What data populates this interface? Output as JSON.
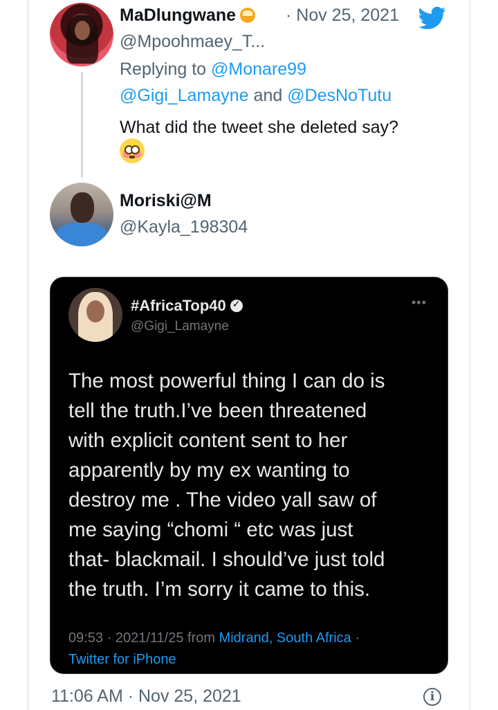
{
  "reply": {
    "display_name": "MaDlungwane",
    "name_emoji": "honey-pot-emoji",
    "date": "· Nov 25, 2021",
    "handle": "@Mpoohmaey_T...",
    "replying_prefix": "Replying to ",
    "replying_to": [
      "@Monare99",
      "@Gigi_Lamayne",
      "@DesNoTutu"
    ],
    "and": " and ",
    "text": "What did the tweet she deleted say?",
    "text_emoji": "flushed-face-emoji"
  },
  "main": {
    "display_name": "Moriski@M",
    "handle": "@Kayla_198304",
    "timestamp": "11:06 AM · Nov 25, 2021"
  },
  "embedded": {
    "display_name": "#AfricaTop40",
    "handle": "@Gigi_Lamayne",
    "more": "•••",
    "lines": [
      "The most powerful thing I can do is",
      "tell the truth.I’ve been threatened",
      "with explicit content sent to her",
      "apparently by my ex wanting to",
      "destroy me . The video yall saw of",
      "me saying “chomi “ etc was just",
      "that- blackmail. I should’ve just told",
      "the truth. I’m sorry it came to this."
    ],
    "meta_time": "09:53 · 2021/11/25 from ",
    "meta_location": "Midrand, South Africa",
    "meta_sep": " ·",
    "meta_client": "Twitter for iPhone"
  },
  "icons": {
    "brand": "twitter-bird-icon",
    "info": "info-icon"
  },
  "colors": {
    "link": "#1d9bf0",
    "muted": "#536471",
    "card_bg": "#000000"
  }
}
